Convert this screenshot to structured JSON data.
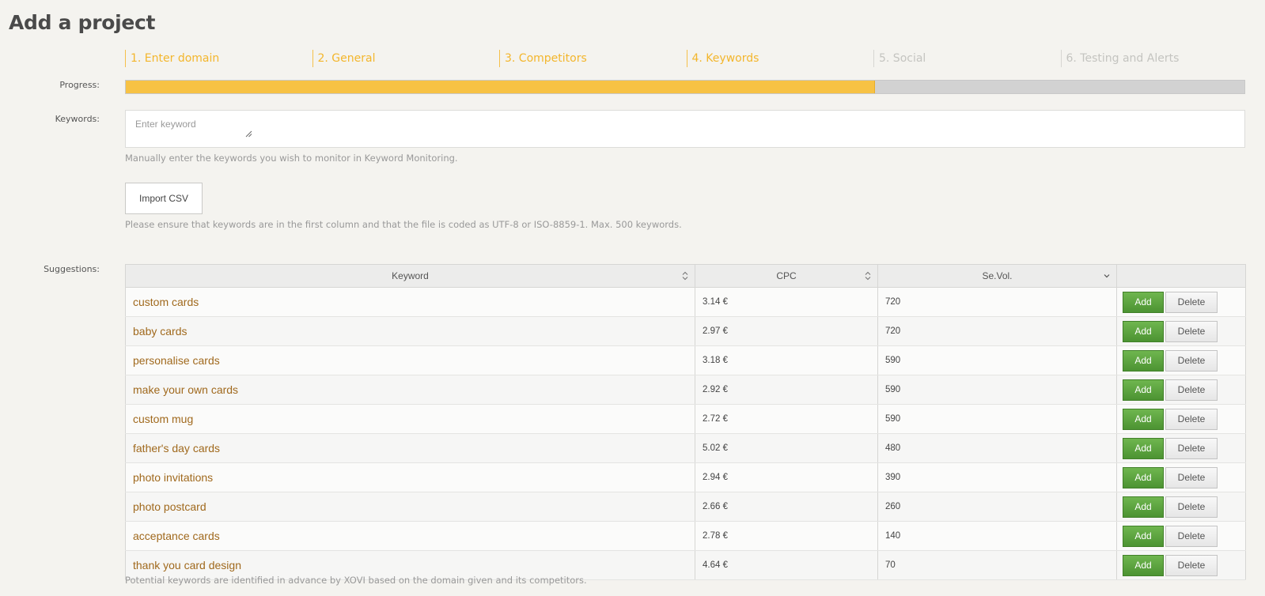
{
  "page_title": "Add a project",
  "steps": [
    {
      "label": "1. Enter domain",
      "state": "done"
    },
    {
      "label": "2. General",
      "state": "done"
    },
    {
      "label": "3. Competitors",
      "state": "done"
    },
    {
      "label": "4. Keywords",
      "state": "current"
    },
    {
      "label": "5. Social",
      "state": "upcoming"
    },
    {
      "label": "6. Testing and Alerts",
      "state": "upcoming"
    }
  ],
  "progress": {
    "label": "Progress:",
    "percent": 67
  },
  "keywords": {
    "label": "Keywords:",
    "placeholder": "Enter keyword",
    "help": "Manually enter the keywords you wish to monitor in Keyword Monitoring."
  },
  "import": {
    "button_label": "Import CSV",
    "help": "Please ensure that keywords are in the first column and that the file is coded as UTF-8 or ISO-8859-1. Max. 500 keywords."
  },
  "suggestions": {
    "label": "Suggestions:",
    "columns": [
      "Keyword",
      "CPC",
      "Se.Vol.",
      ""
    ],
    "add_label": "Add",
    "delete_label": "Delete",
    "rows": [
      {
        "keyword": "custom cards",
        "cpc": "3.14 €",
        "volume": "720"
      },
      {
        "keyword": "baby cards",
        "cpc": "2.97 €",
        "volume": "720"
      },
      {
        "keyword": "personalise cards",
        "cpc": "3.18 €",
        "volume": "590"
      },
      {
        "keyword": "make your own cards",
        "cpc": "2.92 €",
        "volume": "590"
      },
      {
        "keyword": "custom mug",
        "cpc": "2.72 €",
        "volume": "590"
      },
      {
        "keyword": "father's day cards",
        "cpc": "5.02 €",
        "volume": "480"
      },
      {
        "keyword": "photo invitations",
        "cpc": "2.94 €",
        "volume": "390"
      },
      {
        "keyword": "photo postcard",
        "cpc": "2.66 €",
        "volume": "260"
      },
      {
        "keyword": "acceptance cards",
        "cpc": "2.78 €",
        "volume": "140"
      },
      {
        "keyword": "thank you card design",
        "cpc": "4.64 €",
        "volume": "70"
      }
    ],
    "footer_help": "Potential keywords are identified in advance by XOVI based on the domain given and its competitors."
  },
  "colors": {
    "accent": "#f3b62c",
    "progress_fill": "#f7c244",
    "add_button": "#5ca53f",
    "keyword_link": "#a0691d"
  }
}
